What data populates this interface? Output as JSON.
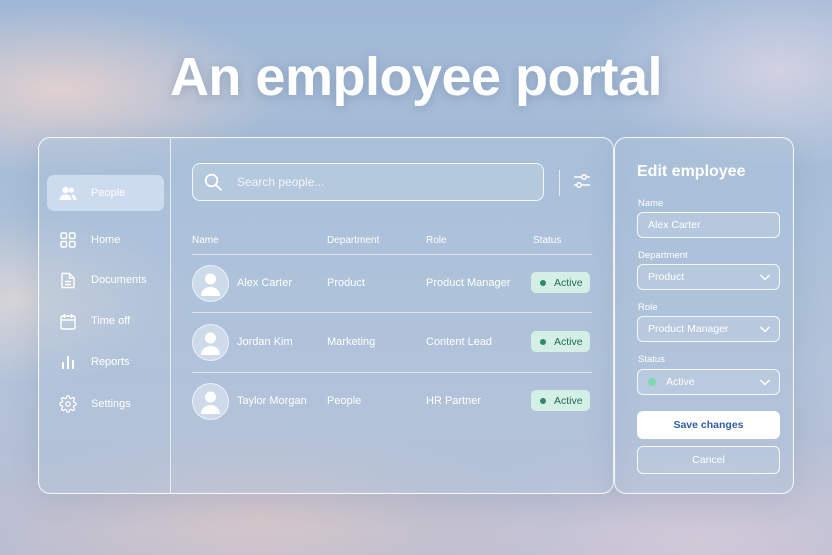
{
  "headline": "An employee portal",
  "sidebar": {
    "items": [
      {
        "label": "People",
        "icon": "people-icon"
      },
      {
        "label": "Home",
        "icon": "grid-icon"
      },
      {
        "label": "Documents",
        "icon": "document-icon"
      },
      {
        "label": "Time off",
        "icon": "calendar-icon"
      },
      {
        "label": "Reports",
        "icon": "bar-chart-icon"
      },
      {
        "label": "Settings",
        "icon": "gear-icon"
      }
    ]
  },
  "search": {
    "placeholder": "Search people...",
    "icon": "search-icon"
  },
  "filter": {
    "icon": "sliders-icon"
  },
  "table": {
    "columns": [
      "Name",
      "Department",
      "Role",
      "Status"
    ],
    "rows": [
      {
        "name": "Alex Carter",
        "department": "Product",
        "role": "Product Manager",
        "status": "Active"
      },
      {
        "name": "Jordan Kim",
        "department": "Marketing",
        "role": "Content Lead",
        "status": "Active"
      },
      {
        "name": "Taylor Morgan",
        "department": "People",
        "role": "HR Partner",
        "status": "Active"
      }
    ]
  },
  "edit_panel": {
    "title": "Edit employee",
    "name_label": "Name",
    "name_value": "Alex Carter",
    "department_label": "Department",
    "department_value": "Product",
    "role_label": "Role",
    "role_value": "Product Manager",
    "status_label": "Status",
    "status_value": "Active",
    "save_label": "Save changes",
    "cancel_label": "Cancel"
  },
  "colors": {
    "badge_bg": "#d4f0e6",
    "badge_text": "#246b55",
    "status_dot": "#2d8a6a",
    "primary_button_text": "#2f5fa7"
  }
}
